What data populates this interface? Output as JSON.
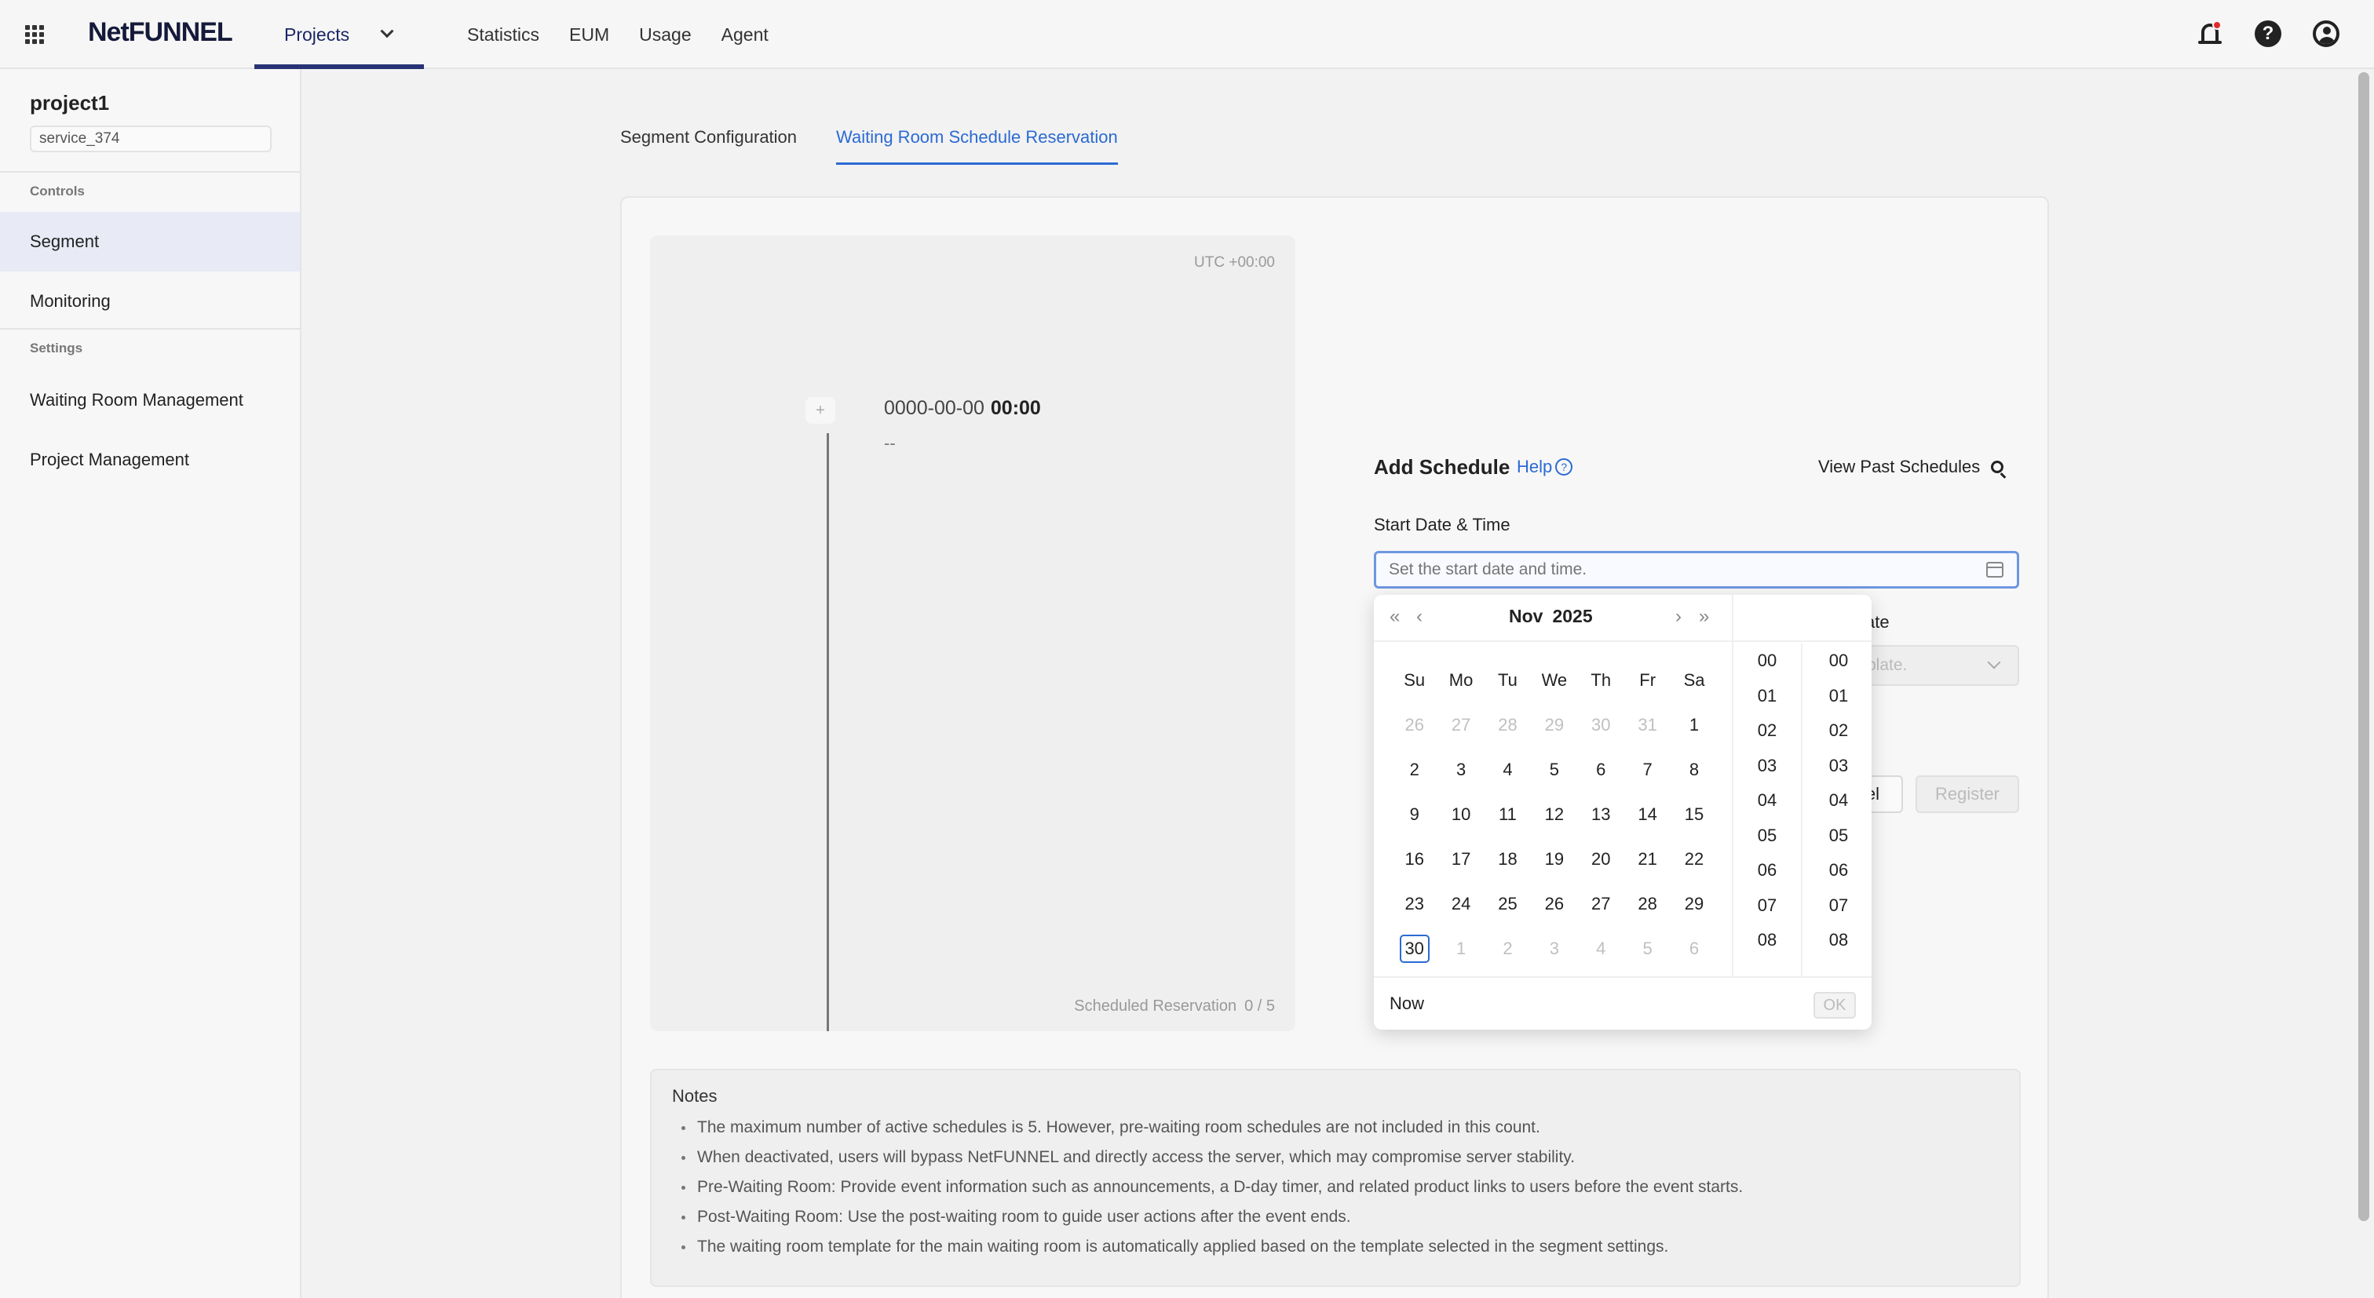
{
  "topbar": {
    "logo": "NetFUNNEL",
    "nav": [
      {
        "label": "Projects",
        "active": true
      },
      {
        "label": "Statistics"
      },
      {
        "label": "EUM"
      },
      {
        "label": "Usage"
      },
      {
        "label": "Agent"
      }
    ],
    "icons": [
      "apps-grid-icon",
      "bell-icon",
      "help-icon",
      "account-icon"
    ],
    "notification_color": "#e02b2b"
  },
  "sidebar": {
    "project_name": "project1",
    "service": "service_374",
    "sections": [
      {
        "title": "Controls",
        "items": [
          "Segment",
          "Monitoring"
        ]
      },
      {
        "title": "Settings",
        "items": [
          "Waiting Room Management",
          "Project Management"
        ]
      }
    ],
    "active_item": "Segment"
  },
  "tabs": [
    "Segment Configuration",
    "Waiting Room Schedule Reservation"
  ],
  "active_tab": "Waiting Room Schedule Reservation",
  "timeline": {
    "utc": "UTC +00:00",
    "plus": "+",
    "date": "0000-00-00",
    "time": "00:00",
    "dash": "--",
    "count_label": "Scheduled Reservation",
    "count_value": "0 / 5"
  },
  "schedule": {
    "title": "Add Schedule",
    "help": "Help",
    "help_q": "?",
    "view_past": "View Past Schedules",
    "start_label": "Start Date & Time",
    "start_placeholder": "Set the start date and time.",
    "template_label_partial": "ate",
    "template_placeholder_partial": "plate.",
    "cancel_partial": "el",
    "register": "Register"
  },
  "picker": {
    "month": "Nov",
    "year": "2025",
    "nav": {
      "prev_year": "«",
      "prev_month": "‹",
      "next_month": "›",
      "next_year": "»"
    },
    "weekdays": [
      "Su",
      "Mo",
      "Tu",
      "We",
      "Th",
      "Fr",
      "Sa"
    ],
    "weeks": [
      [
        [
          "26",
          true
        ],
        [
          "27",
          true
        ],
        [
          "28",
          true
        ],
        [
          "29",
          true
        ],
        [
          "30",
          true
        ],
        [
          "31",
          true
        ],
        [
          "1",
          false
        ]
      ],
      [
        [
          "2",
          false
        ],
        [
          "3",
          false
        ],
        [
          "4",
          false
        ],
        [
          "5",
          false
        ],
        [
          "6",
          false
        ],
        [
          "7",
          false
        ],
        [
          "8",
          false
        ]
      ],
      [
        [
          "9",
          false
        ],
        [
          "10",
          false
        ],
        [
          "11",
          false
        ],
        [
          "12",
          false
        ],
        [
          "13",
          false
        ],
        [
          "14",
          false
        ],
        [
          "15",
          false
        ]
      ],
      [
        [
          "16",
          false
        ],
        [
          "17",
          false
        ],
        [
          "18",
          false
        ],
        [
          "19",
          false
        ],
        [
          "20",
          false
        ],
        [
          "21",
          false
        ],
        [
          "22",
          false
        ]
      ],
      [
        [
          "23",
          false
        ],
        [
          "24",
          false
        ],
        [
          "25",
          false
        ],
        [
          "26",
          false
        ],
        [
          "27",
          false
        ],
        [
          "28",
          false
        ],
        [
          "29",
          false
        ]
      ],
      [
        [
          "30",
          false
        ],
        [
          "1",
          true
        ],
        [
          "2",
          true
        ],
        [
          "3",
          true
        ],
        [
          "4",
          true
        ],
        [
          "5",
          true
        ],
        [
          "6",
          true
        ]
      ]
    ],
    "today": "30",
    "hours": [
      "00",
      "01",
      "02",
      "03",
      "04",
      "05",
      "06",
      "07",
      "08"
    ],
    "minutes": [
      "00",
      "01",
      "02",
      "03",
      "04",
      "05",
      "06",
      "07",
      "08"
    ],
    "now": "Now",
    "ok": "OK"
  },
  "notes": {
    "title": "Notes",
    "items": [
      "The maximum number of active schedules is 5. However, pre-waiting room schedules are not included in this count.",
      "When deactivated, users will bypass NetFUNNEL and directly access the server, which may compromise server stability.",
      "Pre-Waiting Room: Provide event information such as announcements, a D-day timer, and related product links to users before the event starts.",
      "Post-Waiting Room: Use the post-waiting room to guide user actions after the event ends.",
      "The waiting room template for the main waiting room is automatically applied based on the template selected in the segment settings."
    ]
  },
  "colors": {
    "accent": "#2b6ad3",
    "nav_active": "#283375",
    "sidebar_active": "#e8ebf5"
  }
}
